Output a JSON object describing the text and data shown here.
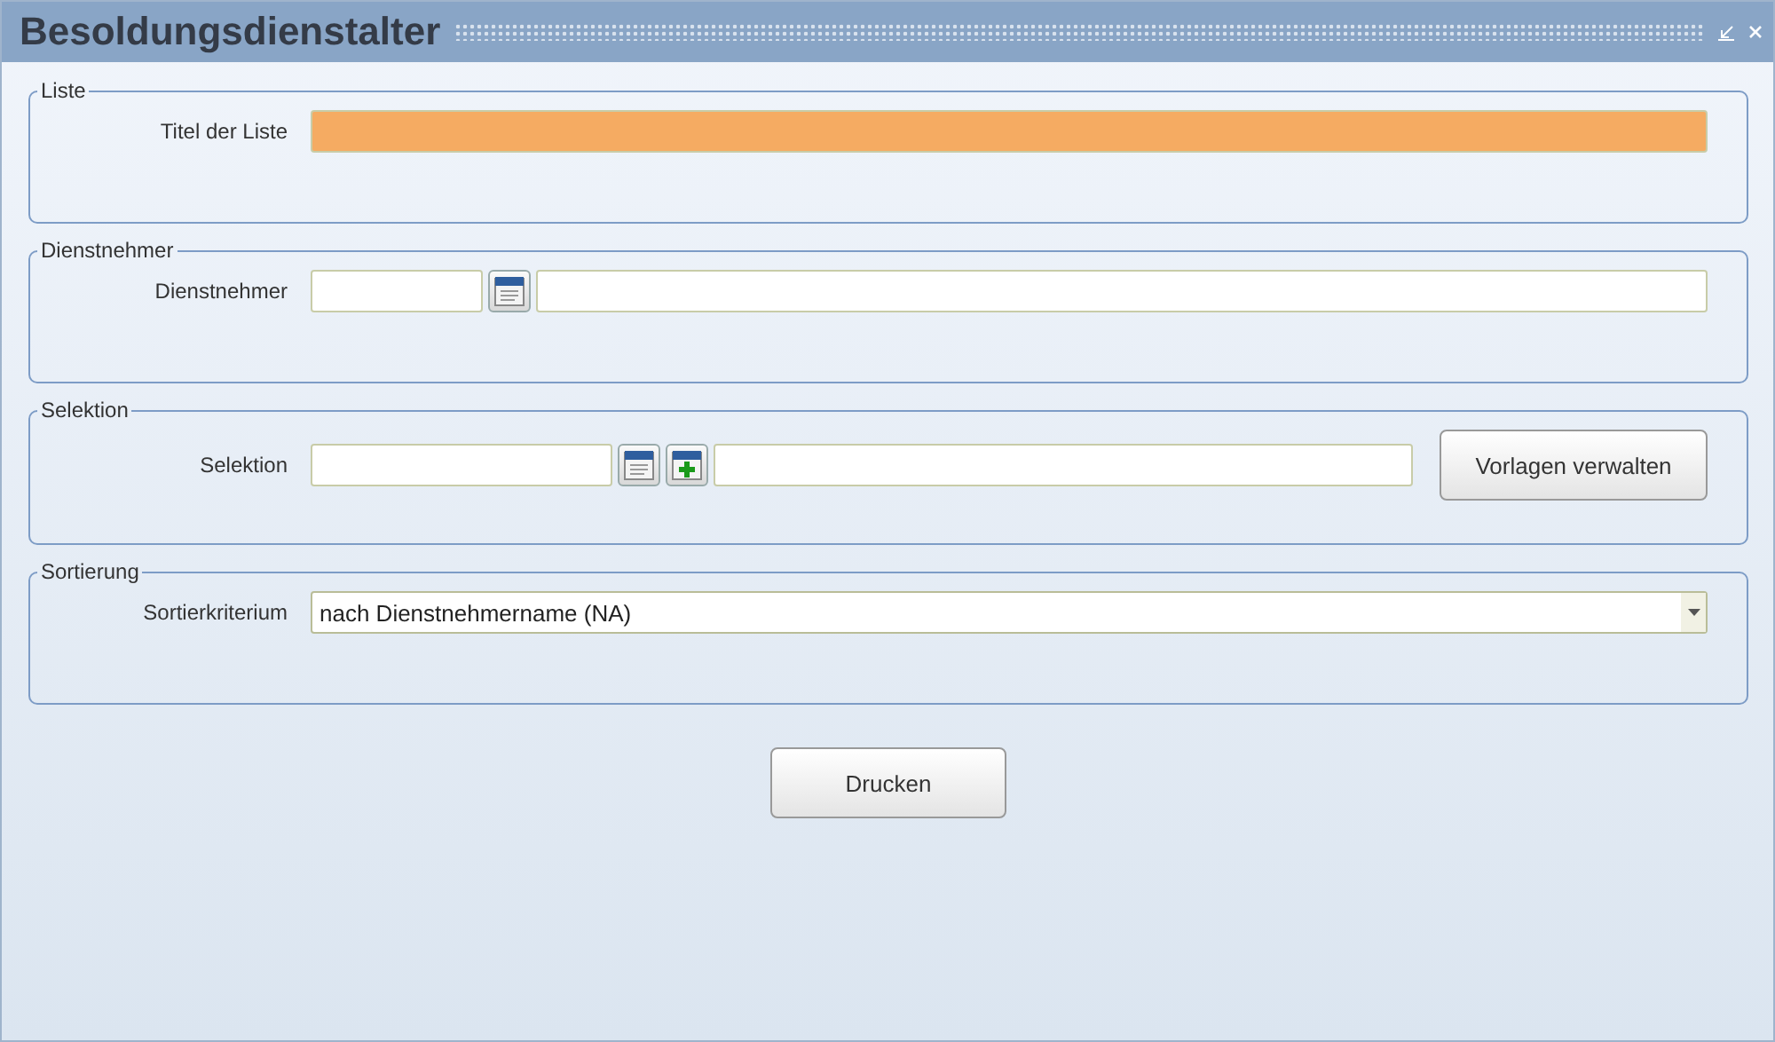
{
  "window": {
    "title": "Besoldungsdienstalter"
  },
  "sections": [
    {
      "legend": "Liste",
      "row": {
        "kind": "text",
        "label": "Titel der Liste",
        "required": true
      }
    },
    {
      "legend": "Dienstnehmer",
      "row": {
        "kind": "lookup",
        "label": "Dienstnehmer",
        "required": false
      }
    },
    {
      "legend": "Selektion",
      "row": {
        "kind": "selection",
        "label": "Selektion",
        "required": false,
        "side_button": "Vorlagen verwalten"
      }
    },
    {
      "legend": "Sortierung",
      "row": {
        "kind": "select",
        "label": "Sortierkriterium",
        "required": false,
        "value": "nach Dienstnehmername (NA)"
      }
    }
  ],
  "buttons": [
    "Drucken"
  ]
}
